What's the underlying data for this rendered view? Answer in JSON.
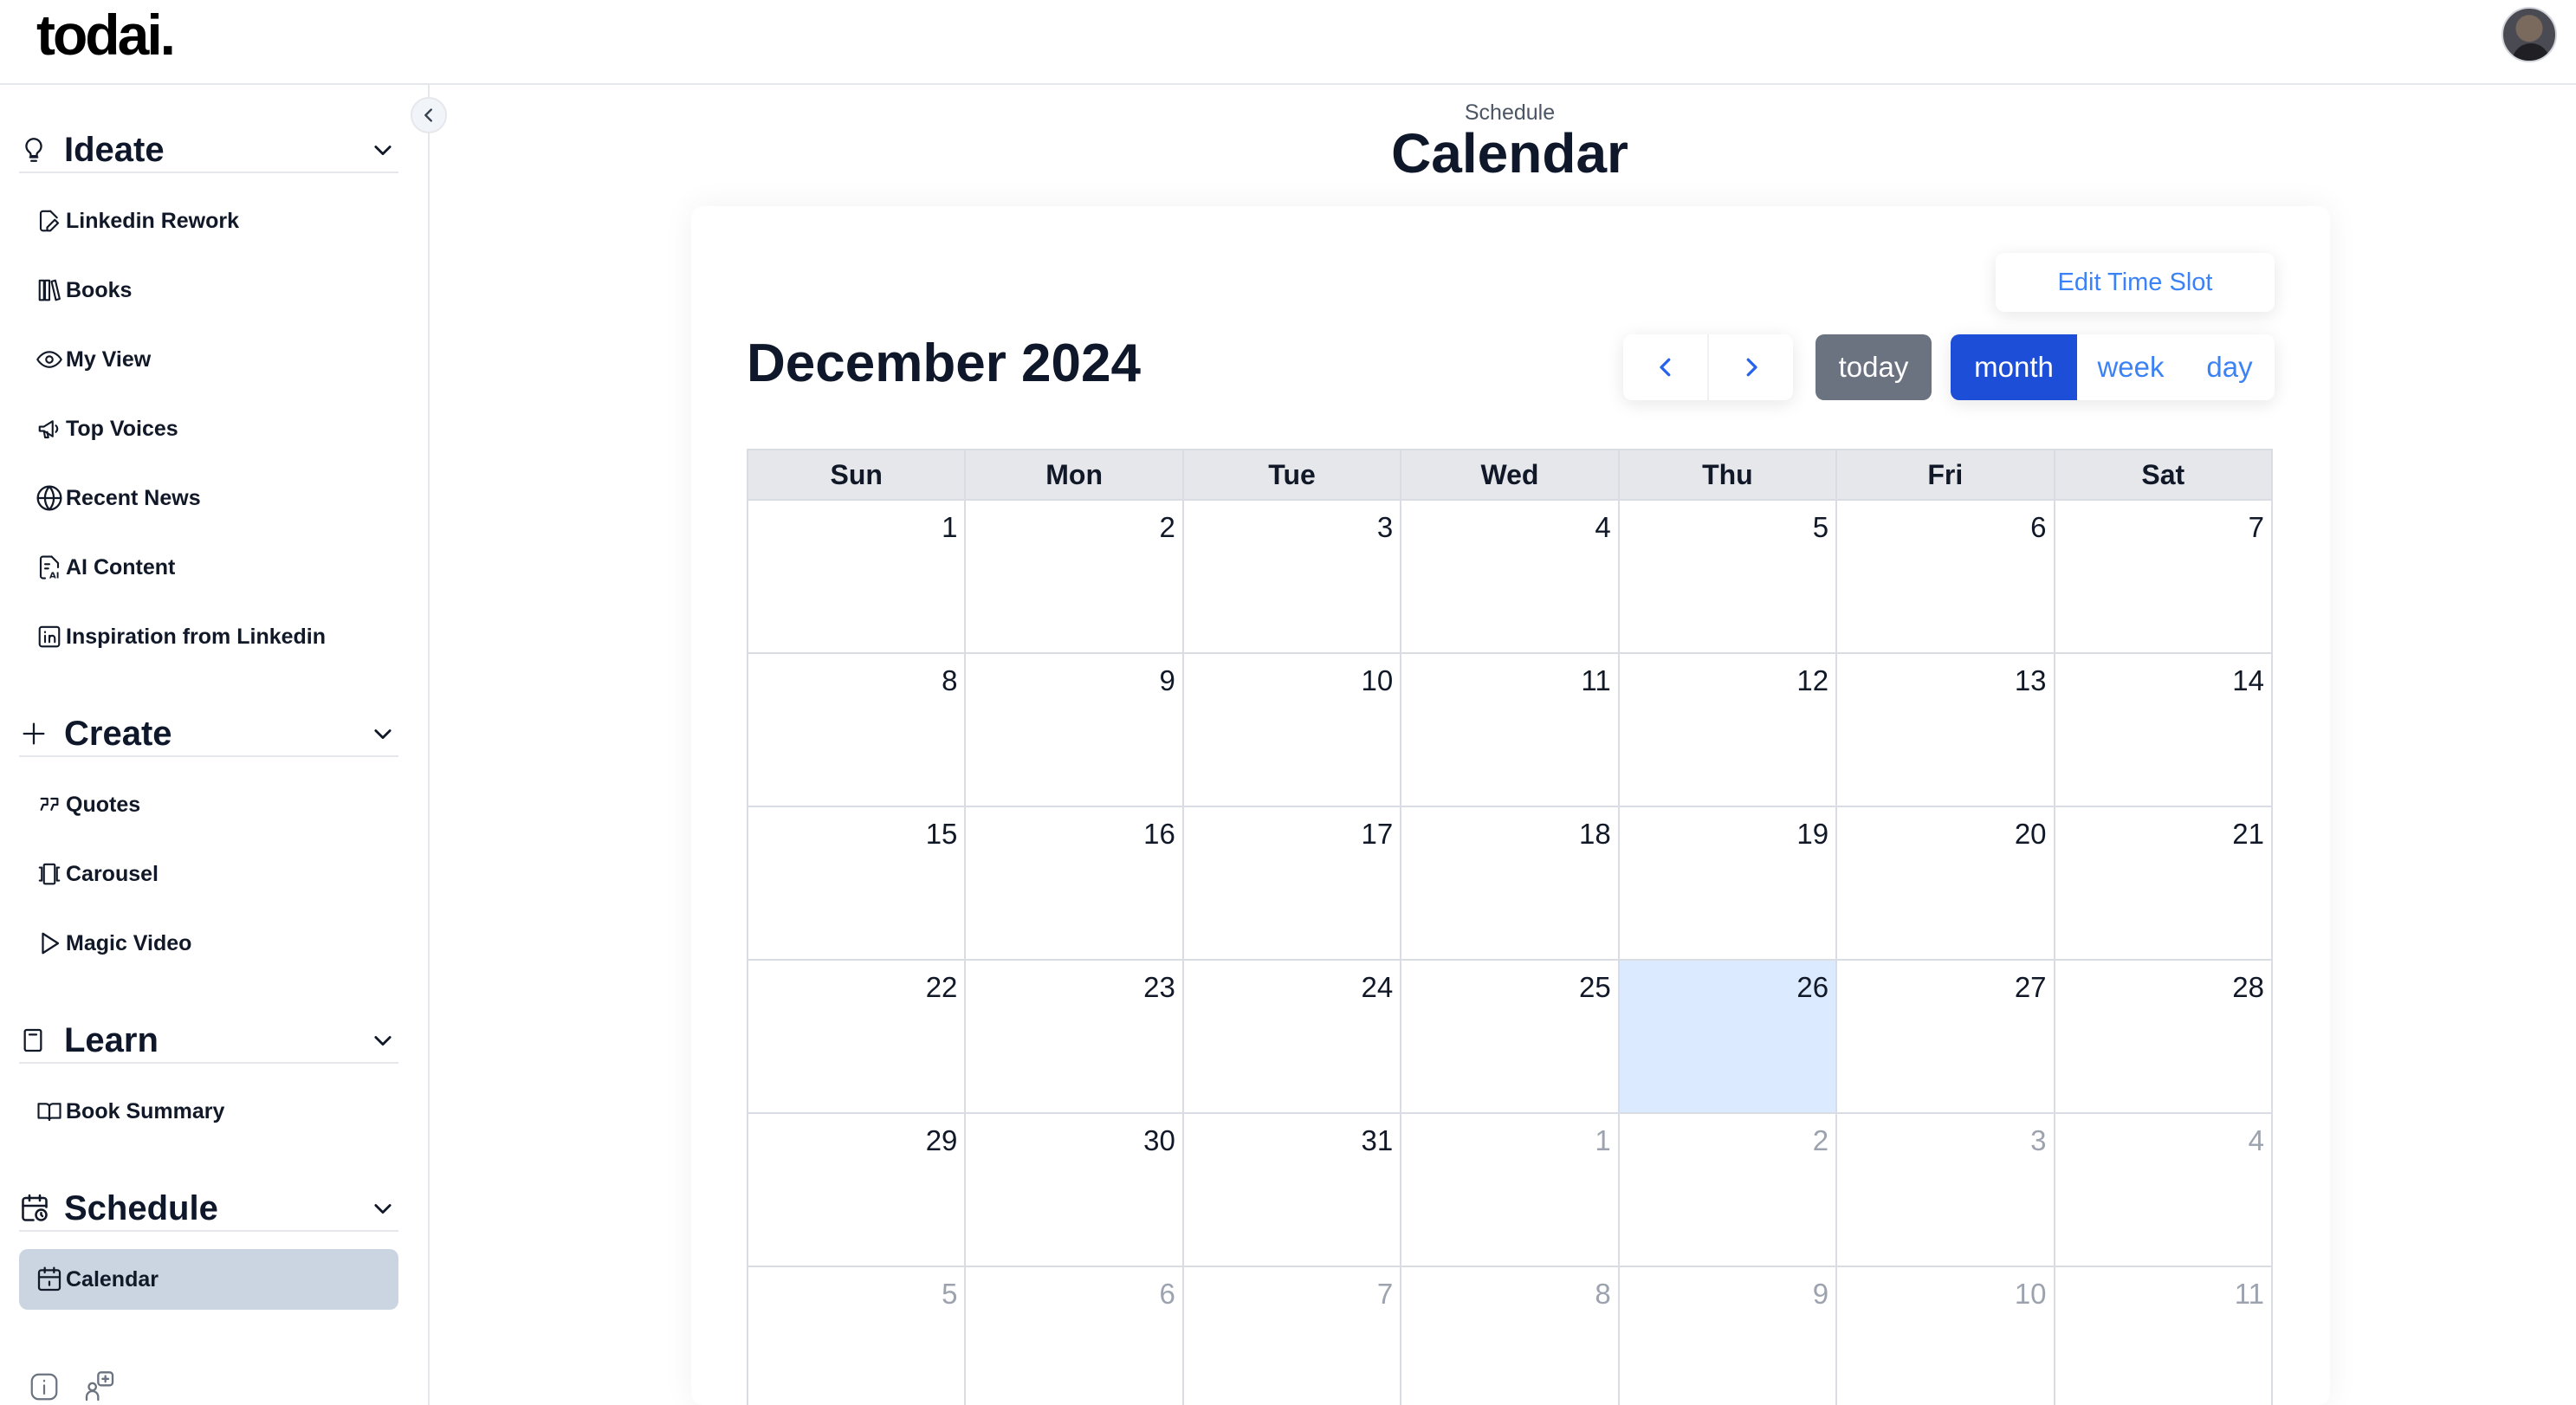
{
  "header": {
    "logo": "todai.",
    "avatar_alt": "user-avatar"
  },
  "sidebar": {
    "sections": [
      {
        "title": "Ideate",
        "icon": "lightbulb-icon",
        "items": [
          {
            "label": "Linkedin Rework",
            "icon": "edit-doc-icon"
          },
          {
            "label": "Books",
            "icon": "books-icon"
          },
          {
            "label": "My View",
            "icon": "eye-icon"
          },
          {
            "label": "Top Voices",
            "icon": "megaphone-icon"
          },
          {
            "label": "Recent News",
            "icon": "globe-icon"
          },
          {
            "label": "AI Content",
            "icon": "ai-doc-icon"
          },
          {
            "label": "Inspiration from Linkedin",
            "icon": "linkedin-icon"
          }
        ]
      },
      {
        "title": "Create",
        "icon": "plus-icon",
        "items": [
          {
            "label": "Quotes",
            "icon": "quote-icon"
          },
          {
            "label": "Carousel",
            "icon": "carousel-icon"
          },
          {
            "label": "Magic Video",
            "icon": "play-icon"
          }
        ]
      },
      {
        "title": "Learn",
        "icon": "book-icon",
        "items": [
          {
            "label": "Book Summary",
            "icon": "open-book-icon"
          }
        ]
      },
      {
        "title": "Schedule",
        "icon": "calendar-clock-icon",
        "items": [
          {
            "label": "Calendar",
            "icon": "calendar-icon",
            "active": true
          }
        ]
      }
    ]
  },
  "main": {
    "breadcrumb": "Schedule",
    "title": "Calendar"
  },
  "calendar": {
    "edit_time_slot": "Edit Time Slot",
    "month_title": "December 2024",
    "today_label": "today",
    "views": {
      "month": "month",
      "week": "week",
      "day": "day"
    },
    "selected_view": "month",
    "weekdays": [
      "Sun",
      "Mon",
      "Tue",
      "Wed",
      "Thu",
      "Fri",
      "Sat"
    ],
    "weeks": [
      [
        {
          "d": "1"
        },
        {
          "d": "2"
        },
        {
          "d": "3"
        },
        {
          "d": "4"
        },
        {
          "d": "5"
        },
        {
          "d": "6"
        },
        {
          "d": "7"
        }
      ],
      [
        {
          "d": "8"
        },
        {
          "d": "9"
        },
        {
          "d": "10"
        },
        {
          "d": "11"
        },
        {
          "d": "12"
        },
        {
          "d": "13"
        },
        {
          "d": "14"
        }
      ],
      [
        {
          "d": "15"
        },
        {
          "d": "16"
        },
        {
          "d": "17"
        },
        {
          "d": "18"
        },
        {
          "d": "19"
        },
        {
          "d": "20"
        },
        {
          "d": "21"
        }
      ],
      [
        {
          "d": "22"
        },
        {
          "d": "23"
        },
        {
          "d": "24"
        },
        {
          "d": "25"
        },
        {
          "d": "26",
          "today": true
        },
        {
          "d": "27"
        },
        {
          "d": "28"
        }
      ],
      [
        {
          "d": "29"
        },
        {
          "d": "30"
        },
        {
          "d": "31"
        },
        {
          "d": "1",
          "other": true
        },
        {
          "d": "2",
          "other": true
        },
        {
          "d": "3",
          "other": true
        },
        {
          "d": "4",
          "other": true
        }
      ],
      [
        {
          "d": "5",
          "other": true
        },
        {
          "d": "6",
          "other": true
        },
        {
          "d": "7",
          "other": true
        },
        {
          "d": "8",
          "other": true
        },
        {
          "d": "9",
          "other": true
        },
        {
          "d": "10",
          "other": true
        },
        {
          "d": "11",
          "other": true
        }
      ]
    ]
  },
  "colors": {
    "accent": "#1d4ed8",
    "link": "#3b82f6",
    "today_bg": "#dbeafe",
    "active_nav_bg": "#cbd5e1",
    "today_btn_bg": "#6b7280"
  }
}
